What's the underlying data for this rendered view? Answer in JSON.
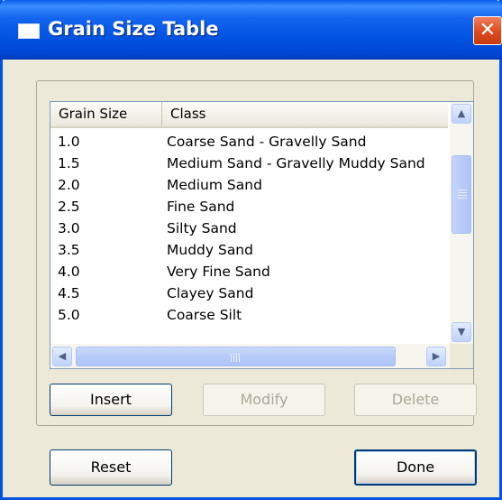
{
  "window": {
    "title": "Grain Size Table",
    "close_glyph": "✕"
  },
  "table": {
    "columns": [
      "Grain Size",
      "Class"
    ],
    "rows": [
      [
        "1.0",
        "Coarse Sand - Gravelly Sand"
      ],
      [
        "1.5",
        "Medium Sand - Gravelly Muddy Sand"
      ],
      [
        "2.0",
        "Medium Sand"
      ],
      [
        "2.5",
        "Fine Sand"
      ],
      [
        "3.0",
        "Silty Sand"
      ],
      [
        "3.5",
        "Muddy Sand"
      ],
      [
        "4.0",
        "Very Fine Sand"
      ],
      [
        "4.5",
        "Clayey Sand"
      ],
      [
        "5.0",
        "Coarse Silt"
      ]
    ]
  },
  "scroll": {
    "up": "▲",
    "down": "▼",
    "left": "◀",
    "right": "▶"
  },
  "buttons": {
    "insert": "Insert",
    "modify": "Modify",
    "delete": "Delete",
    "reset": "Reset",
    "done": "Done"
  }
}
